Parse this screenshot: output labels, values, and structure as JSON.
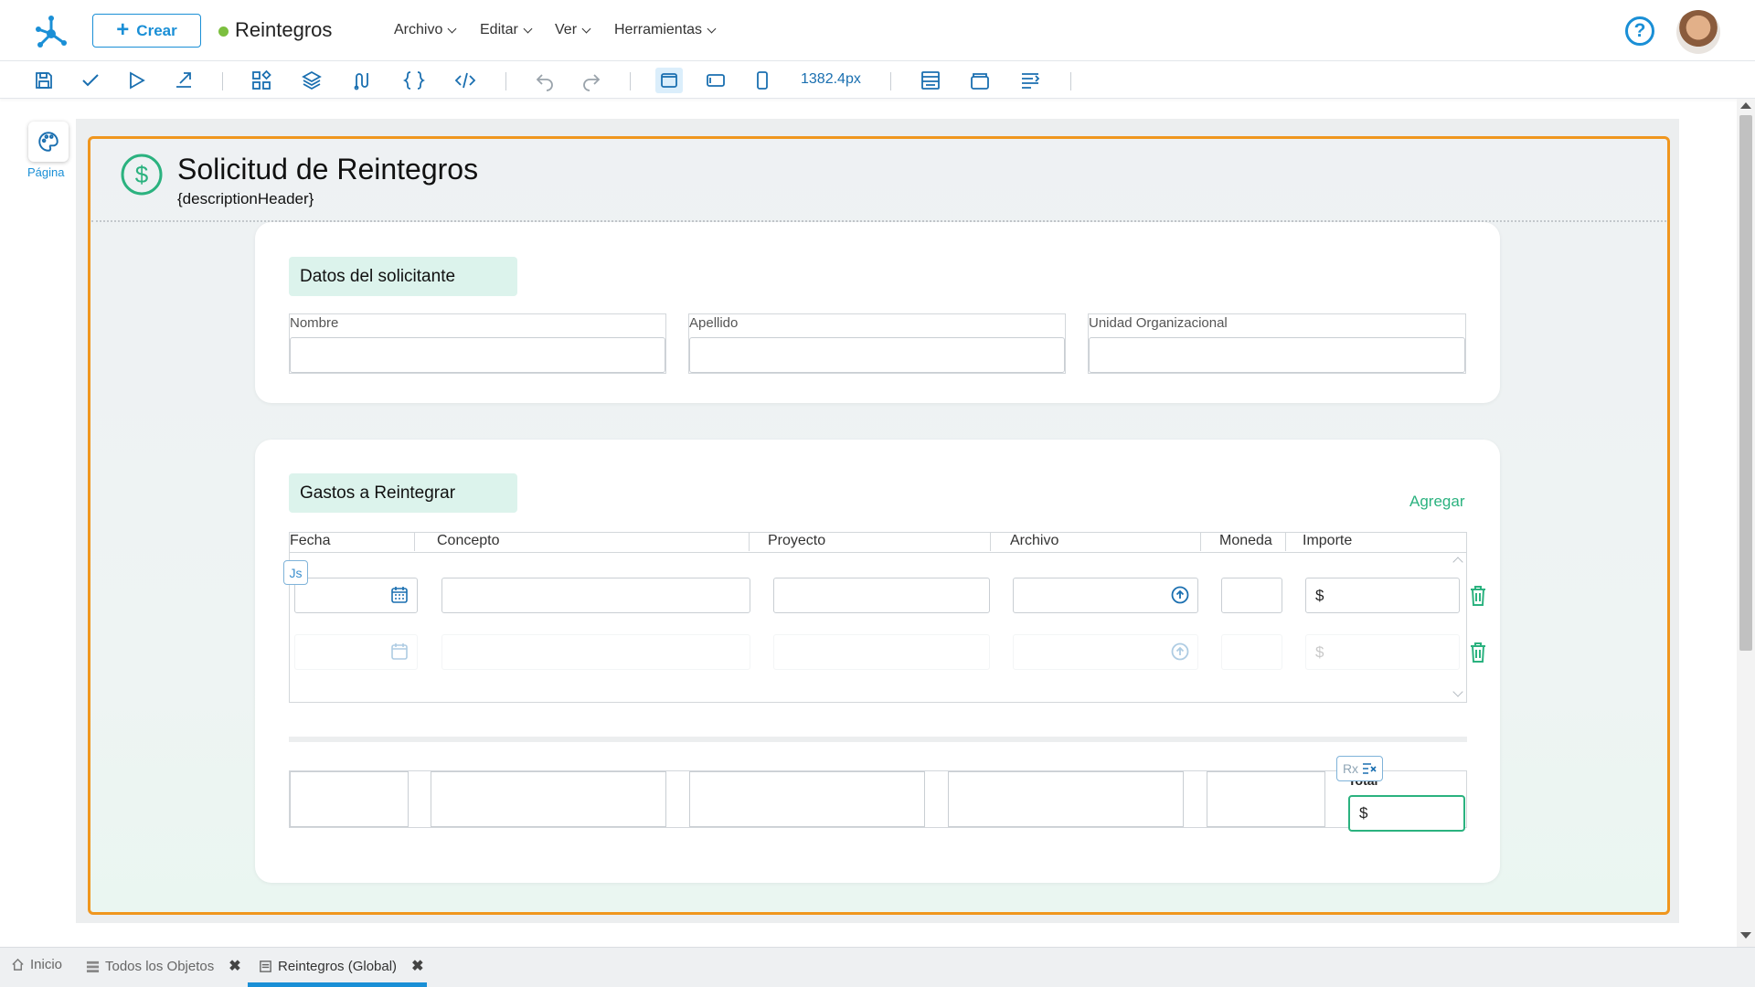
{
  "topbar": {
    "create_label": "Crear",
    "app_title": "Reintegros",
    "status_color": "#7cbf3f",
    "menus": [
      "Archivo",
      "Editar",
      "Ver",
      "Herramientas"
    ],
    "help_icon": "help-circle-icon",
    "avatar": "user-avatar"
  },
  "toolbar": {
    "icons": [
      "save-icon",
      "check-icon",
      "play-icon",
      "export-icon",
      "components-icon",
      "layers-icon",
      "flow-icon",
      "braces-icon",
      "code-icon",
      "undo-icon",
      "redo-icon",
      "desktop-view-icon",
      "tablet-view-icon",
      "mobile-view-icon",
      "layout-icon",
      "container-icon",
      "align-icon"
    ],
    "width_value": "1382.4px"
  },
  "left_rail": {
    "page_tool_label": "Página",
    "page_tool_icon": "palette-icon"
  },
  "form": {
    "title": "Solicitud de Reintegros",
    "subtitle": "{descriptionHeader}",
    "header_icon": "dollar-circle-icon",
    "section1": {
      "title": "Datos del solicitante",
      "fields": [
        "Nombre",
        "Apellido",
        "Unidad Organizacional"
      ]
    },
    "section2": {
      "title": "Gastos a Reintegrar",
      "add_label": "Agregar",
      "columns": [
        "Fecha",
        "Concepto",
        "Proyecto",
        "Archivo",
        "Moneda",
        "Importe"
      ],
      "currency_symbol": "$",
      "js_badge": "Js",
      "rx_badge": "Rx",
      "total_label": "Total",
      "total_value": "$"
    }
  },
  "bottom_tabs": [
    {
      "label": "Inicio",
      "icon": "home-icon"
    },
    {
      "label": "Todos los Objetos",
      "icon": "list-icon"
    },
    {
      "label": "Reintegros (Global)",
      "icon": "form-icon",
      "active": true
    }
  ],
  "colors": {
    "accent": "#1a8fd6",
    "frame": "#f0961e",
    "green": "#2bb27f",
    "section_tag_bg": "#dcf3ec"
  }
}
